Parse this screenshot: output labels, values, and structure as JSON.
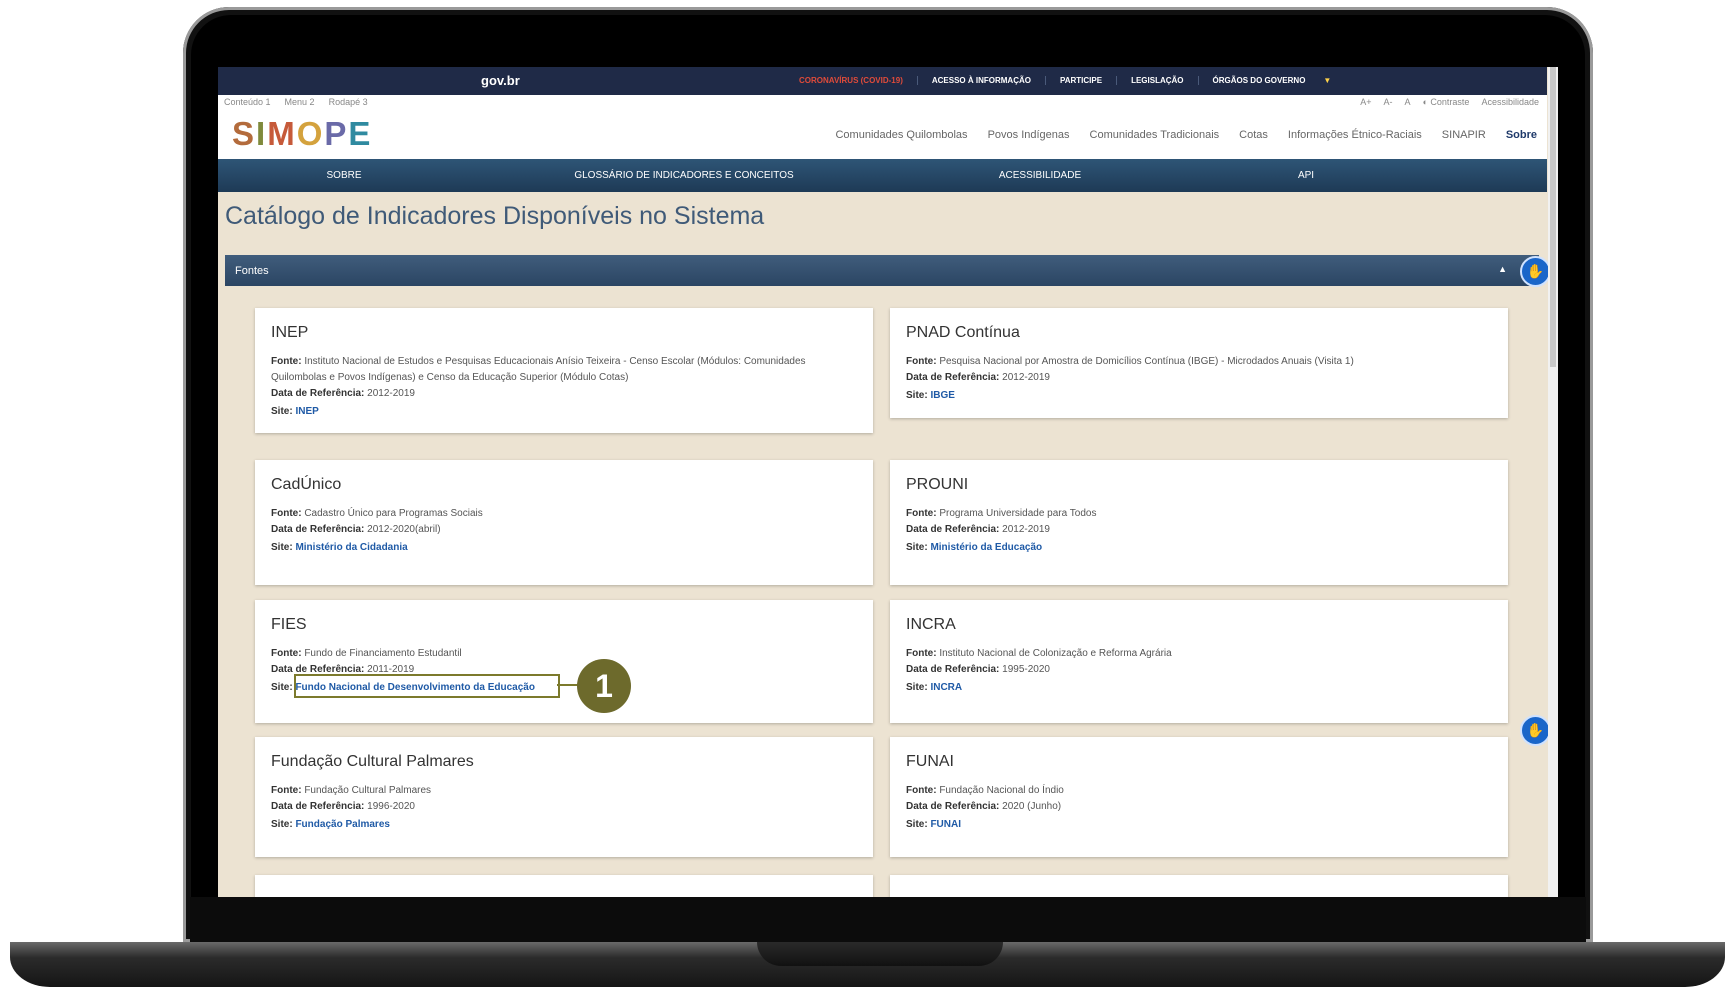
{
  "gov_bar": {
    "logo": "gov.br",
    "links": [
      "CORONAVÍRUS (COVID-19)",
      "ACESSO À INFORMAÇÃO",
      "PARTICIPE",
      "LEGISLAÇÃO",
      "ÓRGÃOS DO GOVERNO"
    ]
  },
  "access_bar": {
    "skip_links": [
      "Conteúdo 1",
      "Menu 2",
      "Rodapé 3"
    ],
    "a11y_links": [
      "A+",
      "A-",
      "A",
      "◐ Contraste",
      "Acessibilidade"
    ]
  },
  "header": {
    "logo_letters": [
      "S",
      "I",
      "M",
      "O",
      "P",
      "E"
    ],
    "logo_colors": [
      "#b36b3c",
      "#7f8a3c",
      "#c65a3a",
      "#d4a23d",
      "#6a6aa8",
      "#2f8aa0"
    ],
    "nav": [
      "Comunidades Quilombolas",
      "Povos Indígenas",
      "Comunidades Tradicionais",
      "Cotas",
      "Informações Étnico-Raciais",
      "SINAPIR",
      "Sobre"
    ]
  },
  "sub_nav": [
    "SOBRE",
    "GLOSSÁRIO DE INDICADORES E CONCEITOS",
    "ACESSIBILIDADE",
    "API"
  ],
  "page": {
    "title": "Catálogo de Indicadores Disponíveis no Sistema",
    "section_label": "Fontes",
    "callout_number": "1"
  },
  "labels": {
    "fonte": "Fonte:",
    "data_ref": "Data de Referência:",
    "site": "Site:"
  },
  "cards": [
    {
      "title": "INEP",
      "fonte": "Instituto Nacional de Estudos e Pesquisas Educacionais Anísio Teixeira - Censo Escolar (Módulos: Comunidades Quilombolas e Povos Indígenas) e Censo da Educação Superior (Módulo Cotas)",
      "data_ref": "2012-2019",
      "site": "INEP"
    },
    {
      "title": "PNAD Contínua",
      "fonte": "Pesquisa Nacional por Amostra de Domicílios Contínua (IBGE) - Microdados Anuais (Visita 1)",
      "data_ref": "2012-2019",
      "site": "IBGE"
    },
    {
      "title": "CadÚnico",
      "fonte": "Cadastro Único para Programas Sociais",
      "data_ref": "2012-2020(abril)",
      "site": "Ministério da Cidadania"
    },
    {
      "title": "PROUNI",
      "fonte": "Programa Universidade para Todos",
      "data_ref": "2012-2019",
      "site": "Ministério da Educação"
    },
    {
      "title": "FIES",
      "fonte": "Fundo de Financiamento Estudantil",
      "data_ref": "2011-2019",
      "site": "Fundo Nacional de Desenvolvimento da Educação"
    },
    {
      "title": "INCRA",
      "fonte": "Instituto Nacional de Colonização e Reforma Agrária",
      "data_ref": "1995-2020",
      "site": "INCRA"
    },
    {
      "title": "Fundação Cultural Palmares",
      "fonte": "Fundação Cultural Palmares",
      "data_ref": "1996-2020",
      "site": "Fundação Palmares"
    },
    {
      "title": "FUNAI",
      "fonte": "Fundação Nacional do Índio",
      "data_ref": "2020 (Junho)",
      "site": "FUNAI"
    }
  ]
}
